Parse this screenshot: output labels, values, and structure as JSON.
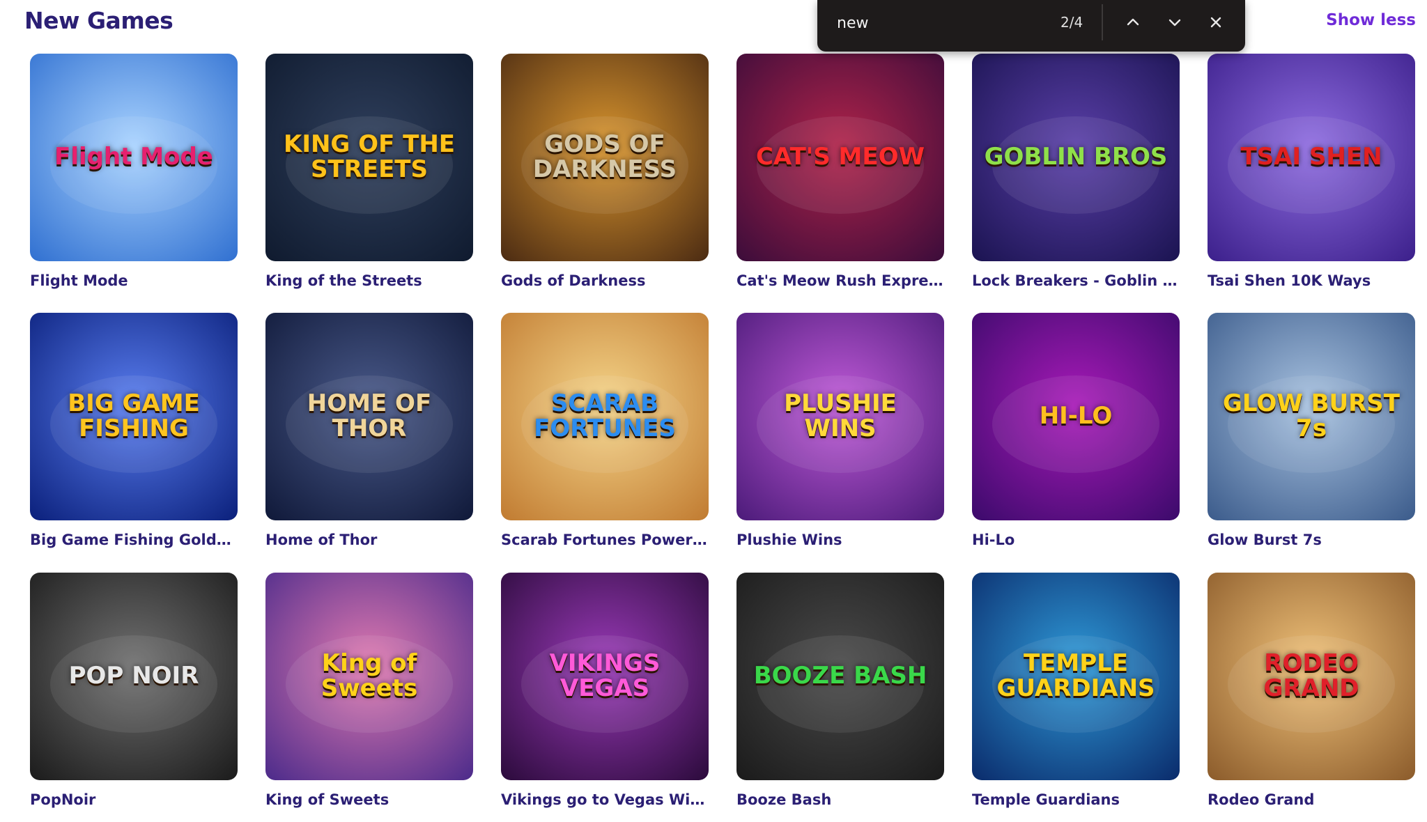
{
  "section": {
    "title": "New Games",
    "toggle_label": "Show less"
  },
  "findbar": {
    "query": "new",
    "match_count": "2/4"
  },
  "games": [
    {
      "title": "Flight Mode",
      "art": "Flight Mode",
      "bg1": "#2f6fd0",
      "bg2": "#a9d3ff",
      "fg": "#e6206e"
    },
    {
      "title": "King of the Streets",
      "art": "KING OF THE STREETS",
      "bg1": "#0f1a2e",
      "bg2": "#2f3f5c",
      "fg": "#ffc21a"
    },
    {
      "title": "Gods of Darkness",
      "art": "GODS OF DARKNESS",
      "bg1": "#4a2a12",
      "bg2": "#d9952e",
      "fg": "#d6c8a8"
    },
    {
      "title": "Cat's Meow Rush Express",
      "art": "CAT'S MEOW",
      "bg1": "#3a0c3a",
      "bg2": "#b0234a",
      "fg": "#ff2b2b"
    },
    {
      "title": "Lock Breakers - Goblin Bros",
      "art": "GOBLIN BROS",
      "bg1": "#1a1350",
      "bg2": "#5a3fa8",
      "fg": "#8fe04a"
    },
    {
      "title": "Tsai Shen 10K Ways",
      "art": "TSAI SHEN",
      "bg1": "#3b1f8a",
      "bg2": "#8e6ce0",
      "fg": "#e02020"
    },
    {
      "title": "Big Game Fishing Golden ...",
      "art": "BIG GAME FISHING",
      "bg1": "#0a1f7a",
      "bg2": "#5a7ef0",
      "fg": "#ffc51f"
    },
    {
      "title": "Home of Thor",
      "art": "HOME OF THOR",
      "bg1": "#0f1838",
      "bg2": "#4a5a8a",
      "fg": "#f0d59a"
    },
    {
      "title": "Scarab Fortunes Power Co...",
      "art": "SCARAB FORTUNES",
      "bg1": "#c07a30",
      "bg2": "#f5d58a",
      "fg": "#2c8df0"
    },
    {
      "title": "Plushie Wins",
      "art": "PLUSHIE WINS",
      "bg1": "#4a1a78",
      "bg2": "#c05ad8",
      "fg": "#ffd93a"
    },
    {
      "title": "Hi-Lo",
      "art": "HI-LO",
      "bg1": "#3a0a6a",
      "bg2": "#a81ab8",
      "fg": "#ffbf1f"
    },
    {
      "title": "Glow Burst 7s",
      "art": "GLOW BURST 7s",
      "bg1": "#3a5a8a",
      "bg2": "#a8c2e0",
      "fg": "#ffd21a"
    },
    {
      "title": "PopNoir",
      "art": "POP NOIR",
      "bg1": "#1a1a1a",
      "bg2": "#707070",
      "fg": "#e8e8e8"
    },
    {
      "title": "King of Sweets",
      "art": "King of Sweets",
      "bg1": "#4a2a8a",
      "bg2": "#e07ab0",
      "fg": "#ffd21a"
    },
    {
      "title": "Vikings go to Vegas Wild Fi...",
      "art": "VIKINGS VEGAS",
      "bg1": "#2a0a3a",
      "bg2": "#9a3ab8",
      "fg": "#ff5ad8"
    },
    {
      "title": "Booze Bash",
      "art": "BOOZE BASH",
      "bg1": "#1a1a1a",
      "bg2": "#4a4a4a",
      "fg": "#3ad84a"
    },
    {
      "title": "Temple Guardians",
      "art": "TEMPLE GUARDIANS",
      "bg1": "#0a2a6a",
      "bg2": "#2f9ad8",
      "fg": "#ffd21a"
    },
    {
      "title": "Rodeo Grand",
      "art": "RODEO GRAND",
      "bg1": "#8a5a2a",
      "bg2": "#f0c27a",
      "fg": "#e0202a"
    }
  ]
}
